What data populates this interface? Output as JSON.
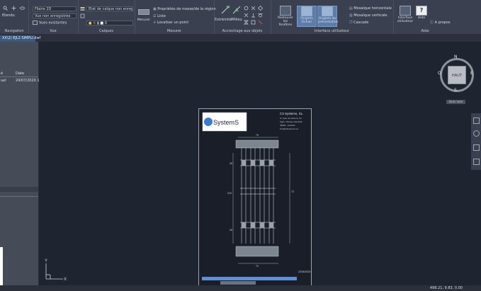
{
  "ribbon": {
    "navigation": {
      "label": "Navigation",
      "zoom_label": "Etendu"
    },
    "vue": {
      "label": "Vue",
      "style_value": "Filaire 2D",
      "view_value": "Vue non enregistrée",
      "view_existing": "Vues existantes"
    },
    "calques": {
      "label": "Calques",
      "state_value": "Etat de calque non enregistré",
      "layer_value": "0"
    },
    "mesurer": {
      "label": "Mesurer",
      "measure_button": "Mesurer",
      "mass_props": "Propriétés de masse/de la région",
      "list": "Liste",
      "locate_point": "Localiser un point"
    },
    "accrochage": {
      "label": "Accrochage aux objets",
      "endpoint": "Extrémité",
      "midpoint": "Milieu"
    },
    "interface": {
      "label": "Interface utilisateur",
      "restore_windows": "Restaurer les fenêtres",
      "file_tabs": "Onglets Fichier",
      "layout_tabs": "Onglets de présentation",
      "tile_horizontal": "Mosaïque horizontale",
      "tile_vertical": "Mosaïque verticale",
      "cascade": "Cascade"
    },
    "aide": {
      "label": "Aide",
      "user_interface": "Interface utilisateur",
      "help": "Aide",
      "about": "A propos"
    }
  },
  "tabs": {
    "document": "XX\\2) EJL2 SIMPLI.dwf"
  },
  "left_panel": {
    "col_name_header": "é",
    "col_date_header": "Date",
    "row_name": "uel",
    "row_date": "24/07/2020 1"
  },
  "viewcube": {
    "face": "HAUT",
    "north": "N",
    "south": "S",
    "east": "E",
    "west": "O",
    "sub_label": "Sans nom"
  },
  "drawing": {
    "company": "C3 Systems, SL.",
    "addr1": "C/ Juan de Herrera, 24",
    "addr2": "Pgno. Parque Industrial",
    "addr3": "46960 - ALDAIA",
    "addr4": "info@c3systems.es",
    "logo_text": "SystemS",
    "dim_top": "70",
    "dim_bottom": "70",
    "dim_left_top": "26",
    "dim_left_mid": "210",
    "dim_left_bot": "26",
    "dim_right": "72",
    "date_stamp": "22/05/2020",
    "axis_y": "Y",
    "axis_x": "X"
  },
  "status": {
    "coordinates": "498.21, 9.83, 0.00"
  },
  "colors": {
    "ribbon_bg": "#3a4050",
    "canvas_bg": "#1f2431",
    "active_tab": "#5a7dab",
    "doc_tab": "#3b5a80",
    "panel_bg": "#454b57"
  }
}
